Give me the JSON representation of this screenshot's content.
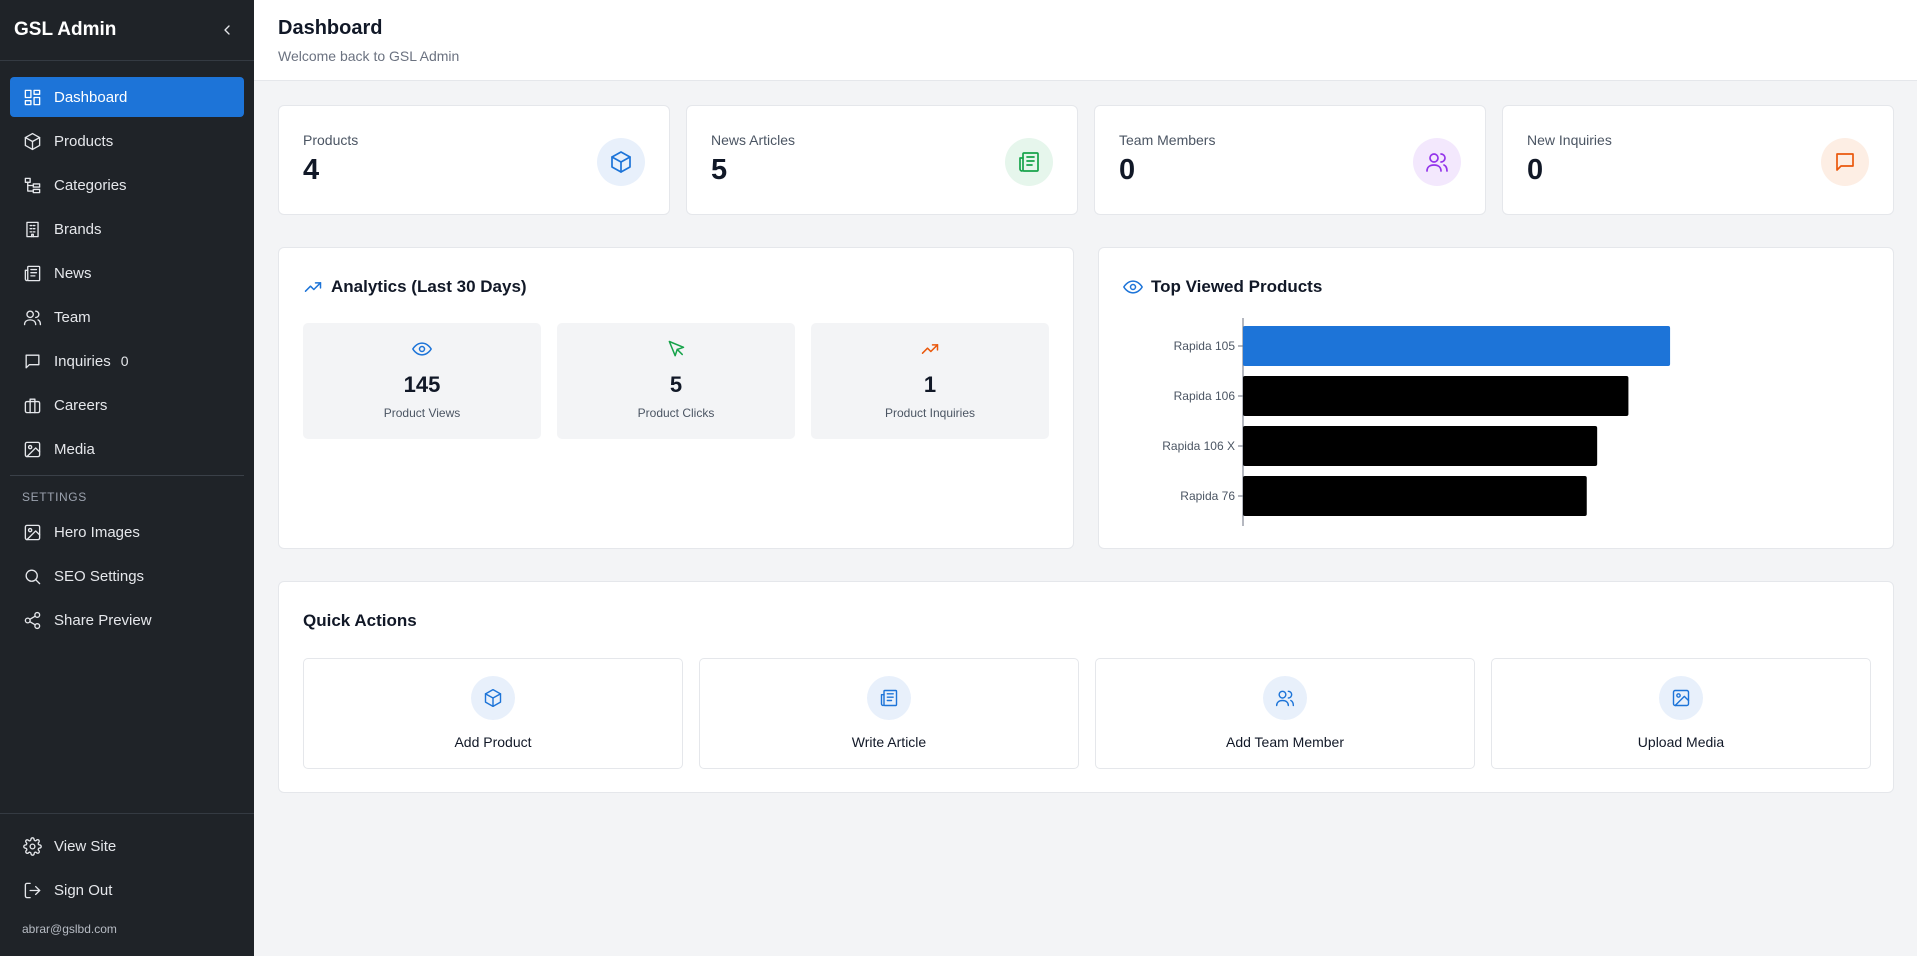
{
  "app": {
    "title": "GSL Admin"
  },
  "sidebar": {
    "items": [
      {
        "label": "Dashboard",
        "icon": "dashboard-icon",
        "active": true
      },
      {
        "label": "Products",
        "icon": "box-icon"
      },
      {
        "label": "Categories",
        "icon": "folder-tree-icon"
      },
      {
        "label": "Brands",
        "icon": "building-icon"
      },
      {
        "label": "News",
        "icon": "newspaper-icon"
      },
      {
        "label": "Team",
        "icon": "users-icon"
      },
      {
        "label": "Inquiries",
        "icon": "message-icon",
        "badge": "0"
      },
      {
        "label": "Careers",
        "icon": "briefcase-icon"
      },
      {
        "label": "Media",
        "icon": "image-icon"
      }
    ],
    "settings_label": "SETTINGS",
    "settings_items": [
      {
        "label": "Hero Images",
        "icon": "image-icon"
      },
      {
        "label": "SEO Settings",
        "icon": "search-icon"
      },
      {
        "label": "Share Preview",
        "icon": "share-icon"
      }
    ],
    "bottom_items": [
      {
        "label": "View Site",
        "icon": "gear-icon"
      },
      {
        "label": "Sign Out",
        "icon": "sign-out-icon"
      }
    ],
    "user_email": "abrar@gslbd.com"
  },
  "header": {
    "title": "Dashboard",
    "subtitle": "Welcome back to GSL Admin"
  },
  "stats": [
    {
      "label": "Products",
      "value": "4",
      "icon": "box-icon",
      "color": "#1d74d8",
      "bg": "#e8f0fb"
    },
    {
      "label": "News Articles",
      "value": "5",
      "icon": "newspaper-icon",
      "color": "#16a34a",
      "bg": "#e6f6ec"
    },
    {
      "label": "Team Members",
      "value": "0",
      "icon": "users-icon",
      "color": "#9333ea",
      "bg": "#f3e8fd"
    },
    {
      "label": "New Inquiries",
      "value": "0",
      "icon": "message-icon",
      "color": "#ea580c",
      "bg": "#fdeee4"
    }
  ],
  "analytics": {
    "title": "Analytics (Last 30 Days)",
    "metrics": [
      {
        "value": "145",
        "label": "Product Views",
        "icon": "eye-icon",
        "color": "#1d74d8"
      },
      {
        "value": "5",
        "label": "Product Clicks",
        "icon": "cursor-icon",
        "color": "#16a34a"
      },
      {
        "value": "1",
        "label": "Product Inquiries",
        "icon": "trending-up-icon",
        "color": "#ea580c"
      }
    ]
  },
  "top_viewed": {
    "title": "Top Viewed Products"
  },
  "chart_data": {
    "type": "bar",
    "orientation": "horizontal",
    "categories": [
      "Rapida 105",
      "Rapida 106",
      "Rapida 106 X",
      "Rapida 76"
    ],
    "values": [
      41,
      37,
      34,
      33
    ],
    "bar_colors": [
      "#1d74d8",
      "#000000",
      "#000000",
      "#000000"
    ],
    "xlim": [
      0,
      48
    ],
    "grid": false,
    "legend": "none"
  },
  "quick_actions": {
    "title": "Quick Actions",
    "items": [
      {
        "label": "Add Product",
        "icon": "box-icon"
      },
      {
        "label": "Write Article",
        "icon": "newspaper-icon"
      },
      {
        "label": "Add Team Member",
        "icon": "users-icon"
      },
      {
        "label": "Upload Media",
        "icon": "image-icon"
      }
    ]
  }
}
